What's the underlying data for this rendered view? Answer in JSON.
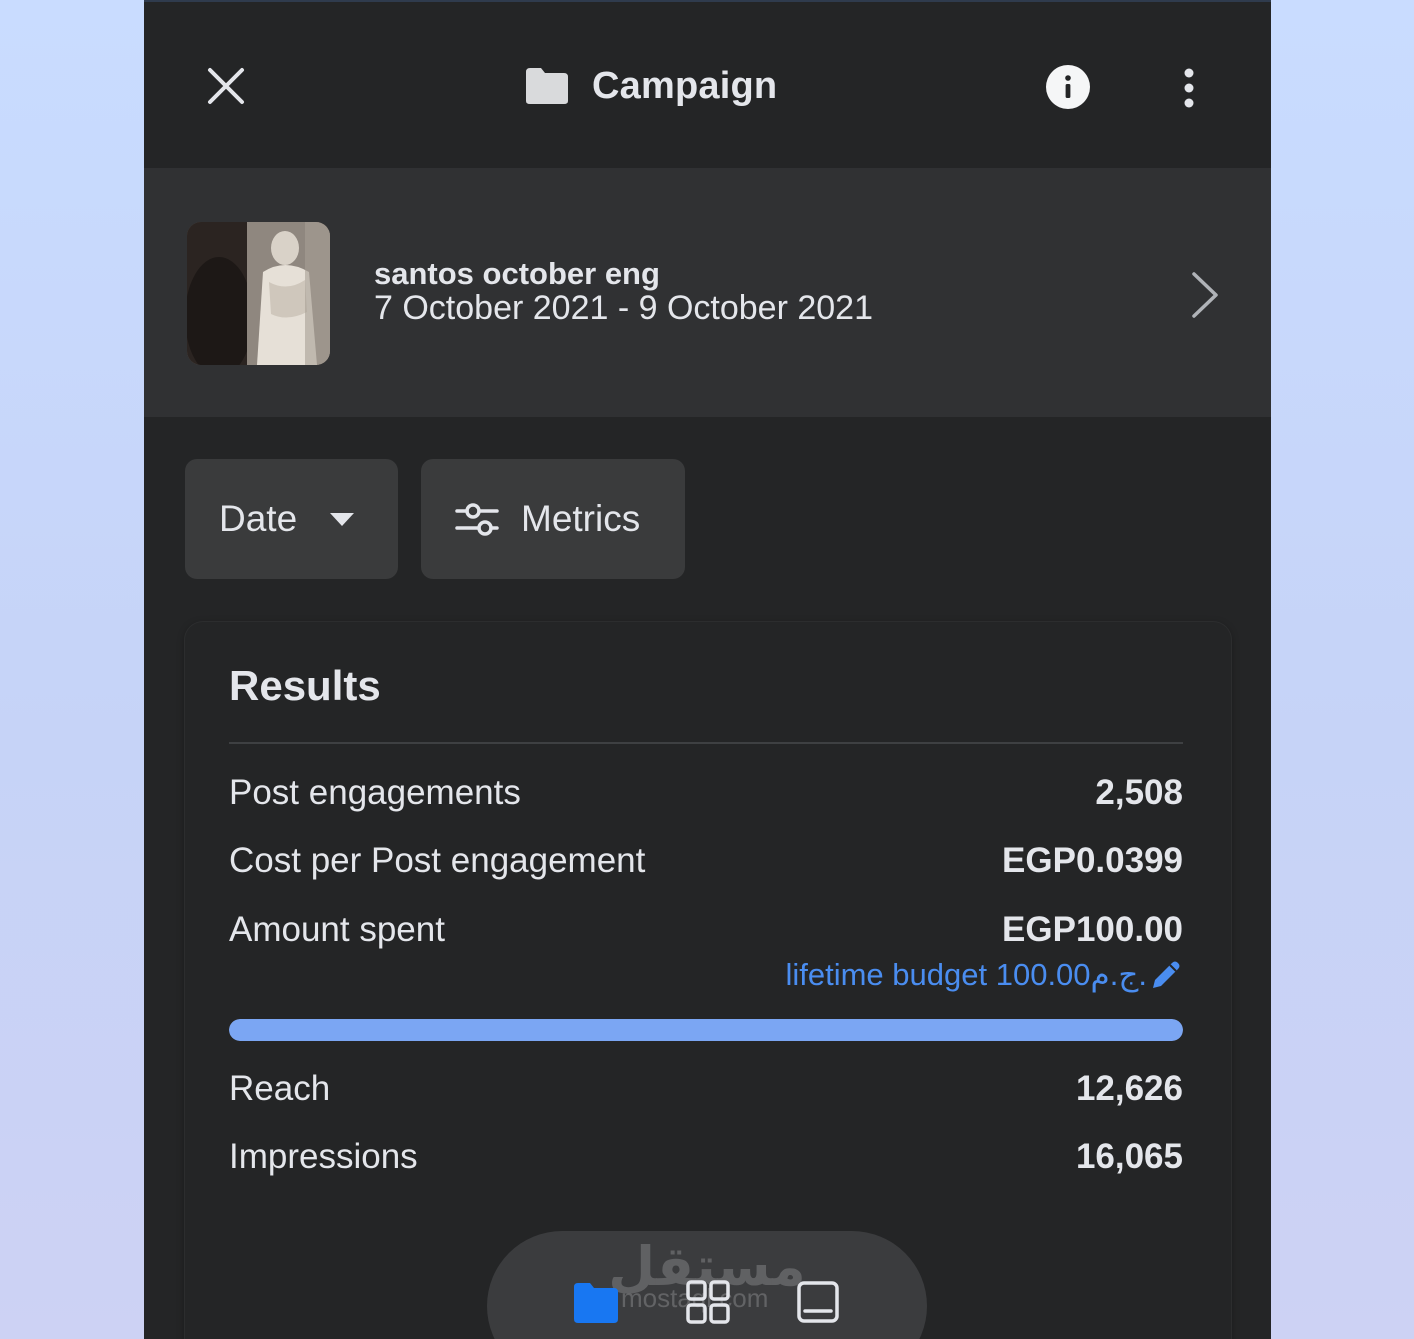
{
  "header": {
    "title": "Campaign",
    "icons": {
      "close": "close-icon",
      "folder": "folder-icon",
      "info": "info-icon",
      "more": "more-vertical-icon"
    }
  },
  "campaign": {
    "name": "santos october eng",
    "dates": "7 October 2021 - 9 October 2021"
  },
  "filters": {
    "date_label": "Date",
    "metrics_label": "Metrics"
  },
  "results": {
    "title": "Results",
    "rows": [
      {
        "label": "Post engagements",
        "value": "2,508"
      },
      {
        "label": "Cost per Post engagement",
        "value": "EGP0.0399"
      },
      {
        "label": "Amount spent",
        "value": "EGP100.00"
      }
    ],
    "budget": {
      "text": "lifetime budget 100.00ج.م.",
      "progress": 1.0
    },
    "rows_after": [
      {
        "label": "Reach",
        "value": "12,626"
      },
      {
        "label": "Impressions",
        "value": "16,065"
      }
    ]
  },
  "watermark": {
    "arabic": "مستقل",
    "latin": "mostaql.com"
  },
  "colors": {
    "panel": "#242526",
    "surface": "#303133",
    "button": "#3a3b3c",
    "text": "#e4e6eb",
    "link": "#4a8df0",
    "progress": "#7ba6f3",
    "nav_active": "#1877f2"
  }
}
